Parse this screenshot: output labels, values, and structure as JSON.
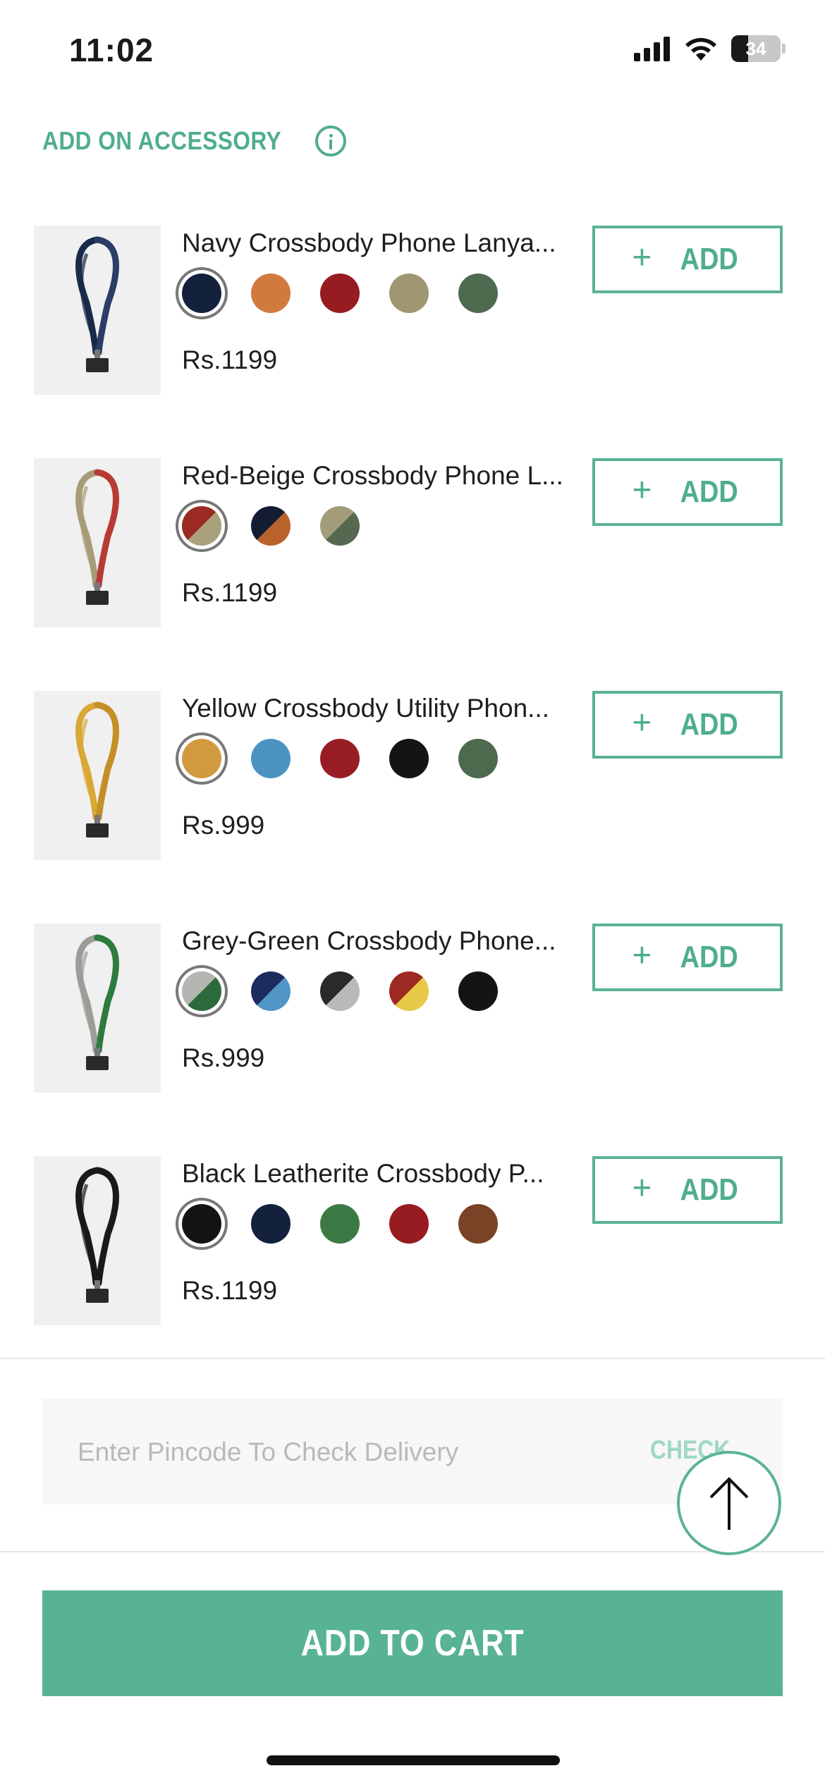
{
  "status_bar": {
    "time": "11:02",
    "battery": "34",
    "battery_level": 0.34
  },
  "section": {
    "title": "ADD ON ACCESSORY",
    "info_icon": "info-icon"
  },
  "products": [
    {
      "name": "Navy Crossbody Phone Lanya...",
      "price": "Rs.1199",
      "add_label": "ADD",
      "strap_colors": [
        "#1a2a4a",
        "#2b3d66"
      ],
      "swatches": [
        [
          "#13213d"
        ],
        [
          "#d07a3e"
        ],
        [
          "#961c22"
        ],
        [
          "#a09672"
        ],
        [
          "#4d6a4f"
        ]
      ]
    },
    {
      "name": "Red-Beige Crossbody Phone L...",
      "price": "Rs.1199",
      "add_label": "ADD",
      "strap_colors": [
        "#a79c75",
        "#b93a34"
      ],
      "swatches": [
        [
          "#9b2a22",
          "#a9a07c"
        ],
        [
          "#141c34",
          "#b9622c"
        ],
        [
          "#a39c7a",
          "#54694f"
        ]
      ]
    },
    {
      "name": "Yellow Crossbody Utility Phon...",
      "price": "Rs.999",
      "add_label": "ADD",
      "strap_colors": [
        "#d9a735",
        "#c48f25"
      ],
      "swatches": [
        [
          "#d19a3f"
        ],
        [
          "#4c93c2"
        ],
        [
          "#981c24"
        ],
        [
          "#141414"
        ],
        [
          "#4d6a4f"
        ]
      ]
    },
    {
      "name": "Grey-Green Crossbody Phone...",
      "price": "Rs.999",
      "add_label": "ADD",
      "strap_colors": [
        "#9b9e96",
        "#2e7b40"
      ],
      "swatches": [
        [
          "#b4b6b2",
          "#2c6a3c"
        ],
        [
          "#1c2c5c",
          "#5296c6"
        ],
        [
          "#2a2a2a",
          "#b9b9b9"
        ],
        [
          "#9c2a22",
          "#e8c847"
        ],
        [
          "#141414"
        ]
      ]
    },
    {
      "name": "Black Leatherite Crossbody P...",
      "price": "Rs.1199",
      "add_label": "ADD",
      "strap_colors": [
        "#1a1a1a",
        "#1a1a1a"
      ],
      "swatches": [
        [
          "#141414"
        ],
        [
          "#13213d"
        ],
        [
          "#3c7a45"
        ],
        [
          "#961c22"
        ],
        [
          "#7a4326"
        ]
      ]
    }
  ],
  "pincode": {
    "placeholder": "Enter Pincode To Check Delivery",
    "value": "",
    "check_label": "CHECK"
  },
  "cart": {
    "label": "ADD TO CART"
  },
  "colors": {
    "accent": "#58b393",
    "accent_text": "#4fae8c"
  }
}
